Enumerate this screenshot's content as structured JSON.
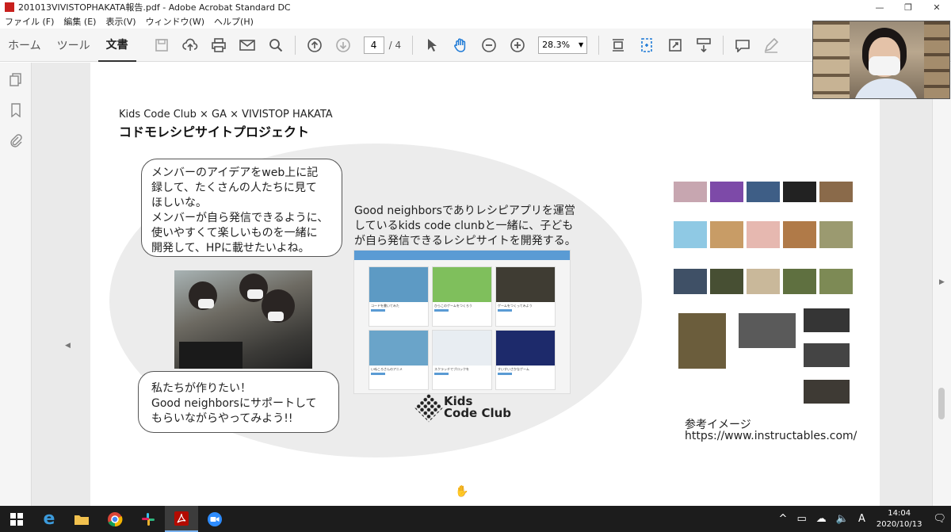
{
  "window": {
    "title": "201013VIVISTOPHAKATA報告.pdf - Adobe Acrobat Standard DC",
    "minimize": "—",
    "maximize": "❐",
    "close": "✕"
  },
  "menu": [
    "ファイル (F)",
    "編集 (E)",
    "表示(V)",
    "ウィンドウ(W)",
    "ヘルプ(H)"
  ],
  "tabs": [
    "ホーム",
    "ツール",
    "文書"
  ],
  "toolbar": {
    "page_current": "4",
    "page_total": "/ 4",
    "zoom": "28.3%",
    "icons": [
      "save-icon",
      "upload-icon",
      "print-icon",
      "mail-icon",
      "search-icon",
      "page-up-icon",
      "page-down-icon",
      "select-cursor-icon",
      "hand-tool-icon",
      "zoom-out-icon",
      "zoom-in-icon",
      "fit-page-icon",
      "rotate-icon",
      "fullscreen-icon",
      "scroll-mode-icon",
      "comment-icon",
      "pen-icon"
    ]
  },
  "slide": {
    "subtitle": "Kids Code Club × GA × VIVISTOP HAKATA",
    "headline": "コドモレシピサイトプロジェクト",
    "bubble1": [
      "メンバーのアイデアをweb上に記",
      "録して、たくさんの人たちに見て",
      "ほしいな。",
      "メンバーが自ら発信できるように、",
      "使いやすくて楽しいものを一緒に",
      "開発して、HPに載せたいよね。"
    ],
    "bubble2": [
      "私たちが作りたい！",
      "Good neighborsにサポートして",
      "もらいながらやってみよう!!"
    ],
    "good_text": [
      "Good neighborsでありレシピアプリを運営",
      "しているkids code clunbと一緒に、子ども",
      "が自ら発信できるレシピサイトを開発する。"
    ],
    "mock_cards": [
      {
        "caption": "コードを書いてみた",
        "color": "#5d9ac4"
      },
      {
        "caption": "ひらこのゲームをつくろう",
        "color": "#7fbf5c"
      },
      {
        "caption": "ゲームをつくってみよう",
        "color": "#3f3c33"
      },
      {
        "caption": "いぬころさんのアニメ",
        "color": "#6aa4c9"
      },
      {
        "caption": "スクラッチでブロックを",
        "color": "#e8edf2"
      },
      {
        "caption": "すいすいさかなゲーム",
        "color": "#1d2a6b"
      }
    ],
    "logo_line1": "Kids",
    "logo_line2": "Code Club",
    "ref_label": "参考イメージ",
    "ref_url": "https://www.instructables.com/"
  },
  "taskbar": {
    "apps": [
      "windows-start-icon",
      "edge-icon",
      "file-explorer-icon",
      "chrome-icon",
      "slack-icon",
      "acrobat-icon",
      "zoom-icon"
    ],
    "time": "14:04",
    "date": "2020/10/13",
    "ime": "A"
  }
}
